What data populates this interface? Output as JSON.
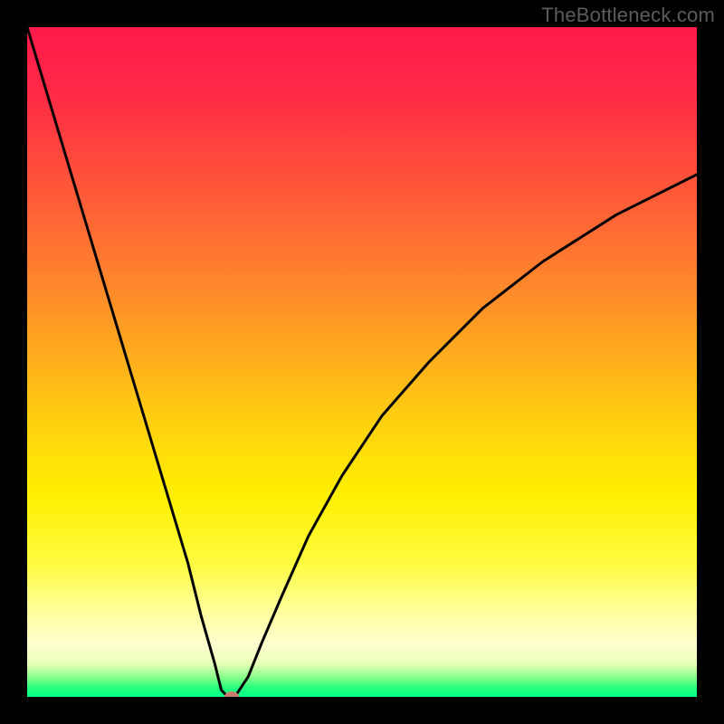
{
  "watermark": {
    "text": "TheBottleneck.com"
  },
  "colors": {
    "top": "#ff1a4a",
    "mid": "#ffd40e",
    "bottom": "#00ff88",
    "curve": "#000000",
    "dot": "#c97d6e",
    "frame_bg": "#000000"
  },
  "chart_data": {
    "type": "line",
    "title": "",
    "xlabel": "",
    "ylabel": "",
    "x_range": [
      0,
      100
    ],
    "y_range": [
      0,
      100
    ],
    "notes": "Bottleneck-style V curve. Y-axis inverted visually (0 at bottom = best/green, 100 at top = worst/red). Single line plunges from top-left to a minimum near x≈30, y≈0, then rises with diminishing slope toward top-right, ending near y≈78 at x=100.",
    "series": [
      {
        "name": "bottleneck-curve",
        "x": [
          0,
          3,
          6,
          9,
          12,
          15,
          18,
          21,
          24,
          26,
          28,
          29,
          30,
          31,
          33,
          35,
          38,
          42,
          47,
          53,
          60,
          68,
          77,
          88,
          100
        ],
        "values": [
          100,
          90,
          80,
          70,
          60,
          50,
          40,
          30,
          20,
          12,
          5,
          1,
          0,
          0,
          3,
          8,
          15,
          24,
          33,
          42,
          50,
          58,
          65,
          72,
          78
        ]
      }
    ],
    "marker": {
      "x": 30.5,
      "y": 0,
      "label": "optimal-point"
    }
  }
}
